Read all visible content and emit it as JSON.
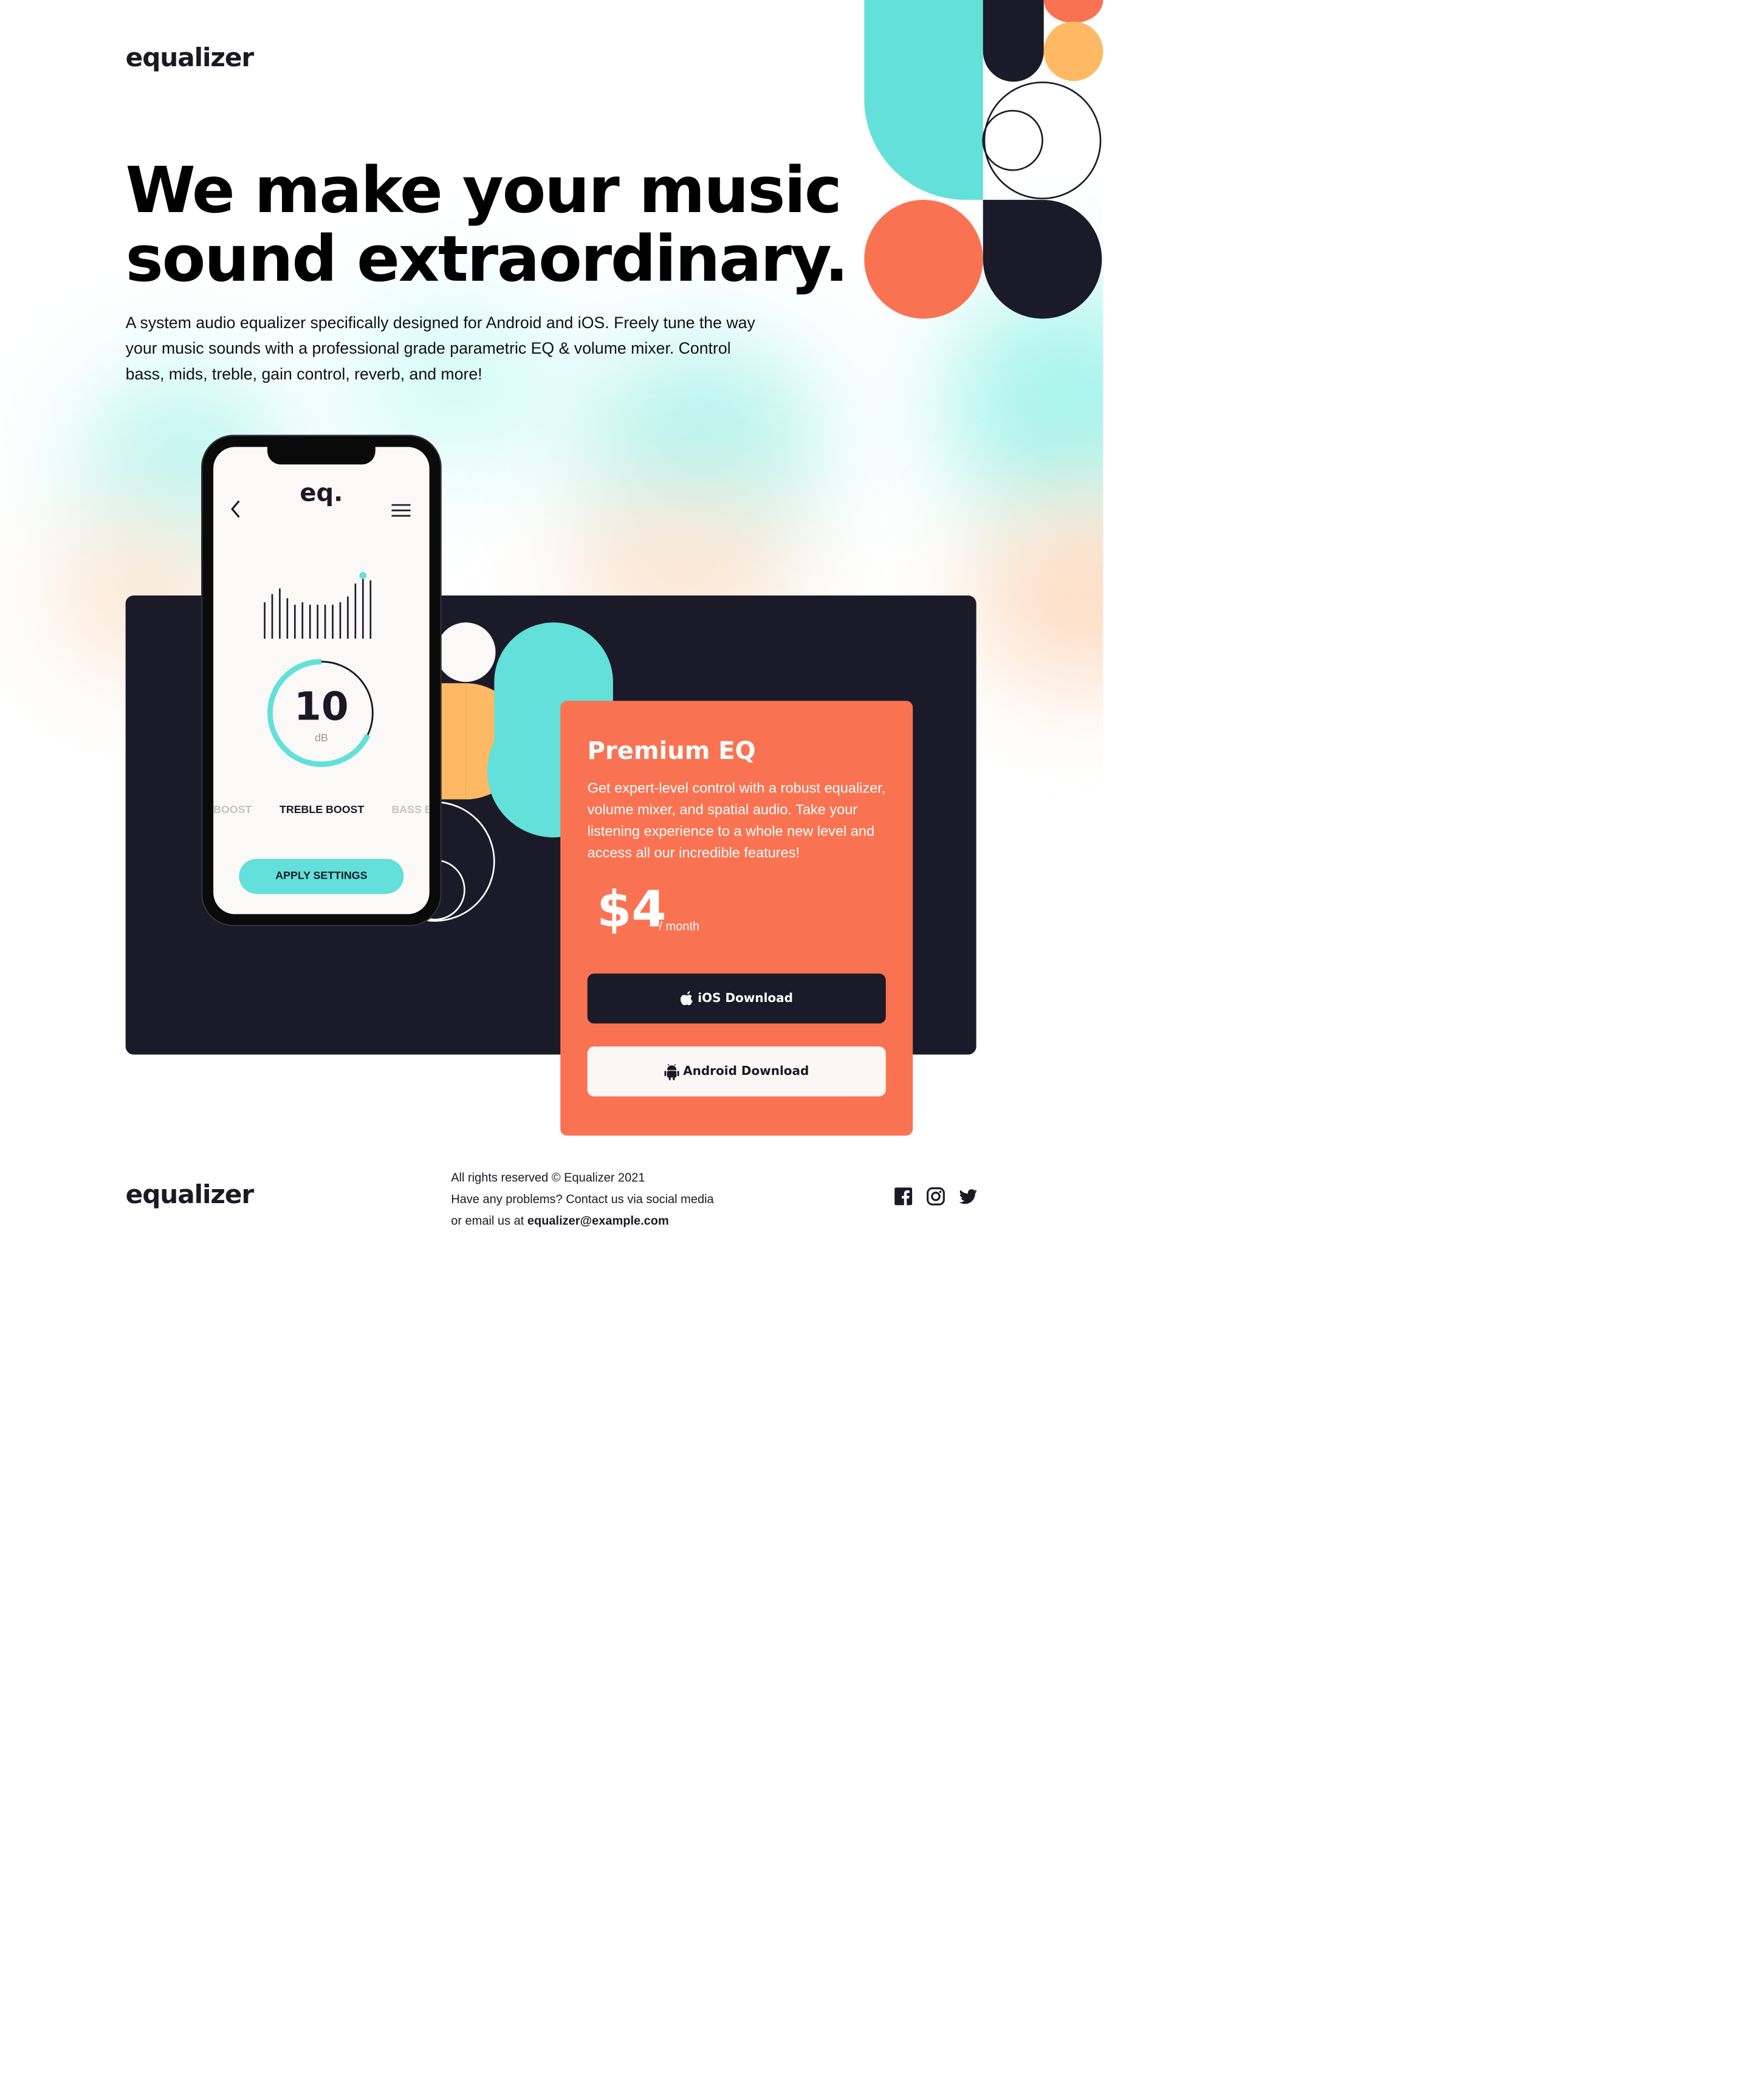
{
  "brand": {
    "logo": "equalizer"
  },
  "hero": {
    "title_line1": "We make your music",
    "title_line2": "sound extraordinary.",
    "description": "A system audio equalizer specifically designed for Android and iOS. Freely tune the way your music sounds with a professional grade parametric EQ & volume mixer. Control bass, mids, treble, gain control, reverb, and more!"
  },
  "phone": {
    "app_title": "eq.",
    "db_value": "10",
    "db_unit": "dB",
    "presets": [
      "BOOST",
      "TREBLE BOOST",
      "BASS B"
    ],
    "apply_label": "APPLY SETTINGS",
    "eq_bar_levels": [
      0.45,
      0.55,
      0.62,
      0.5,
      0.42,
      0.45,
      0.42,
      0.42,
      0.42,
      0.42,
      0.45,
      0.52,
      0.68,
      0.78,
      0.72
    ],
    "dial_level": 0.68
  },
  "premium": {
    "title": "Premium EQ",
    "description": "Get expert-level control with a robust equalizer, volume mixer, and spatial audio. Take your listening experience to a whole new level and access all our incredible features!",
    "price": "$4",
    "period": "/ month",
    "ios_label": "iOS Download",
    "android_label": "Android Download"
  },
  "footer": {
    "logo": "equalizer",
    "line1": "All rights reserved © Equalizer 2021",
    "line2": "Have any problems? Contact us via social media or email us at",
    "email": "equalizer@example.com",
    "social": [
      "facebook-icon",
      "instagram-icon",
      "twitter-icon"
    ]
  },
  "colors": {
    "dark": "#1b1a29",
    "teal": "#62e0d9",
    "orange": "#f97352",
    "yellow": "#ffb964",
    "white": "#faf9f7"
  }
}
